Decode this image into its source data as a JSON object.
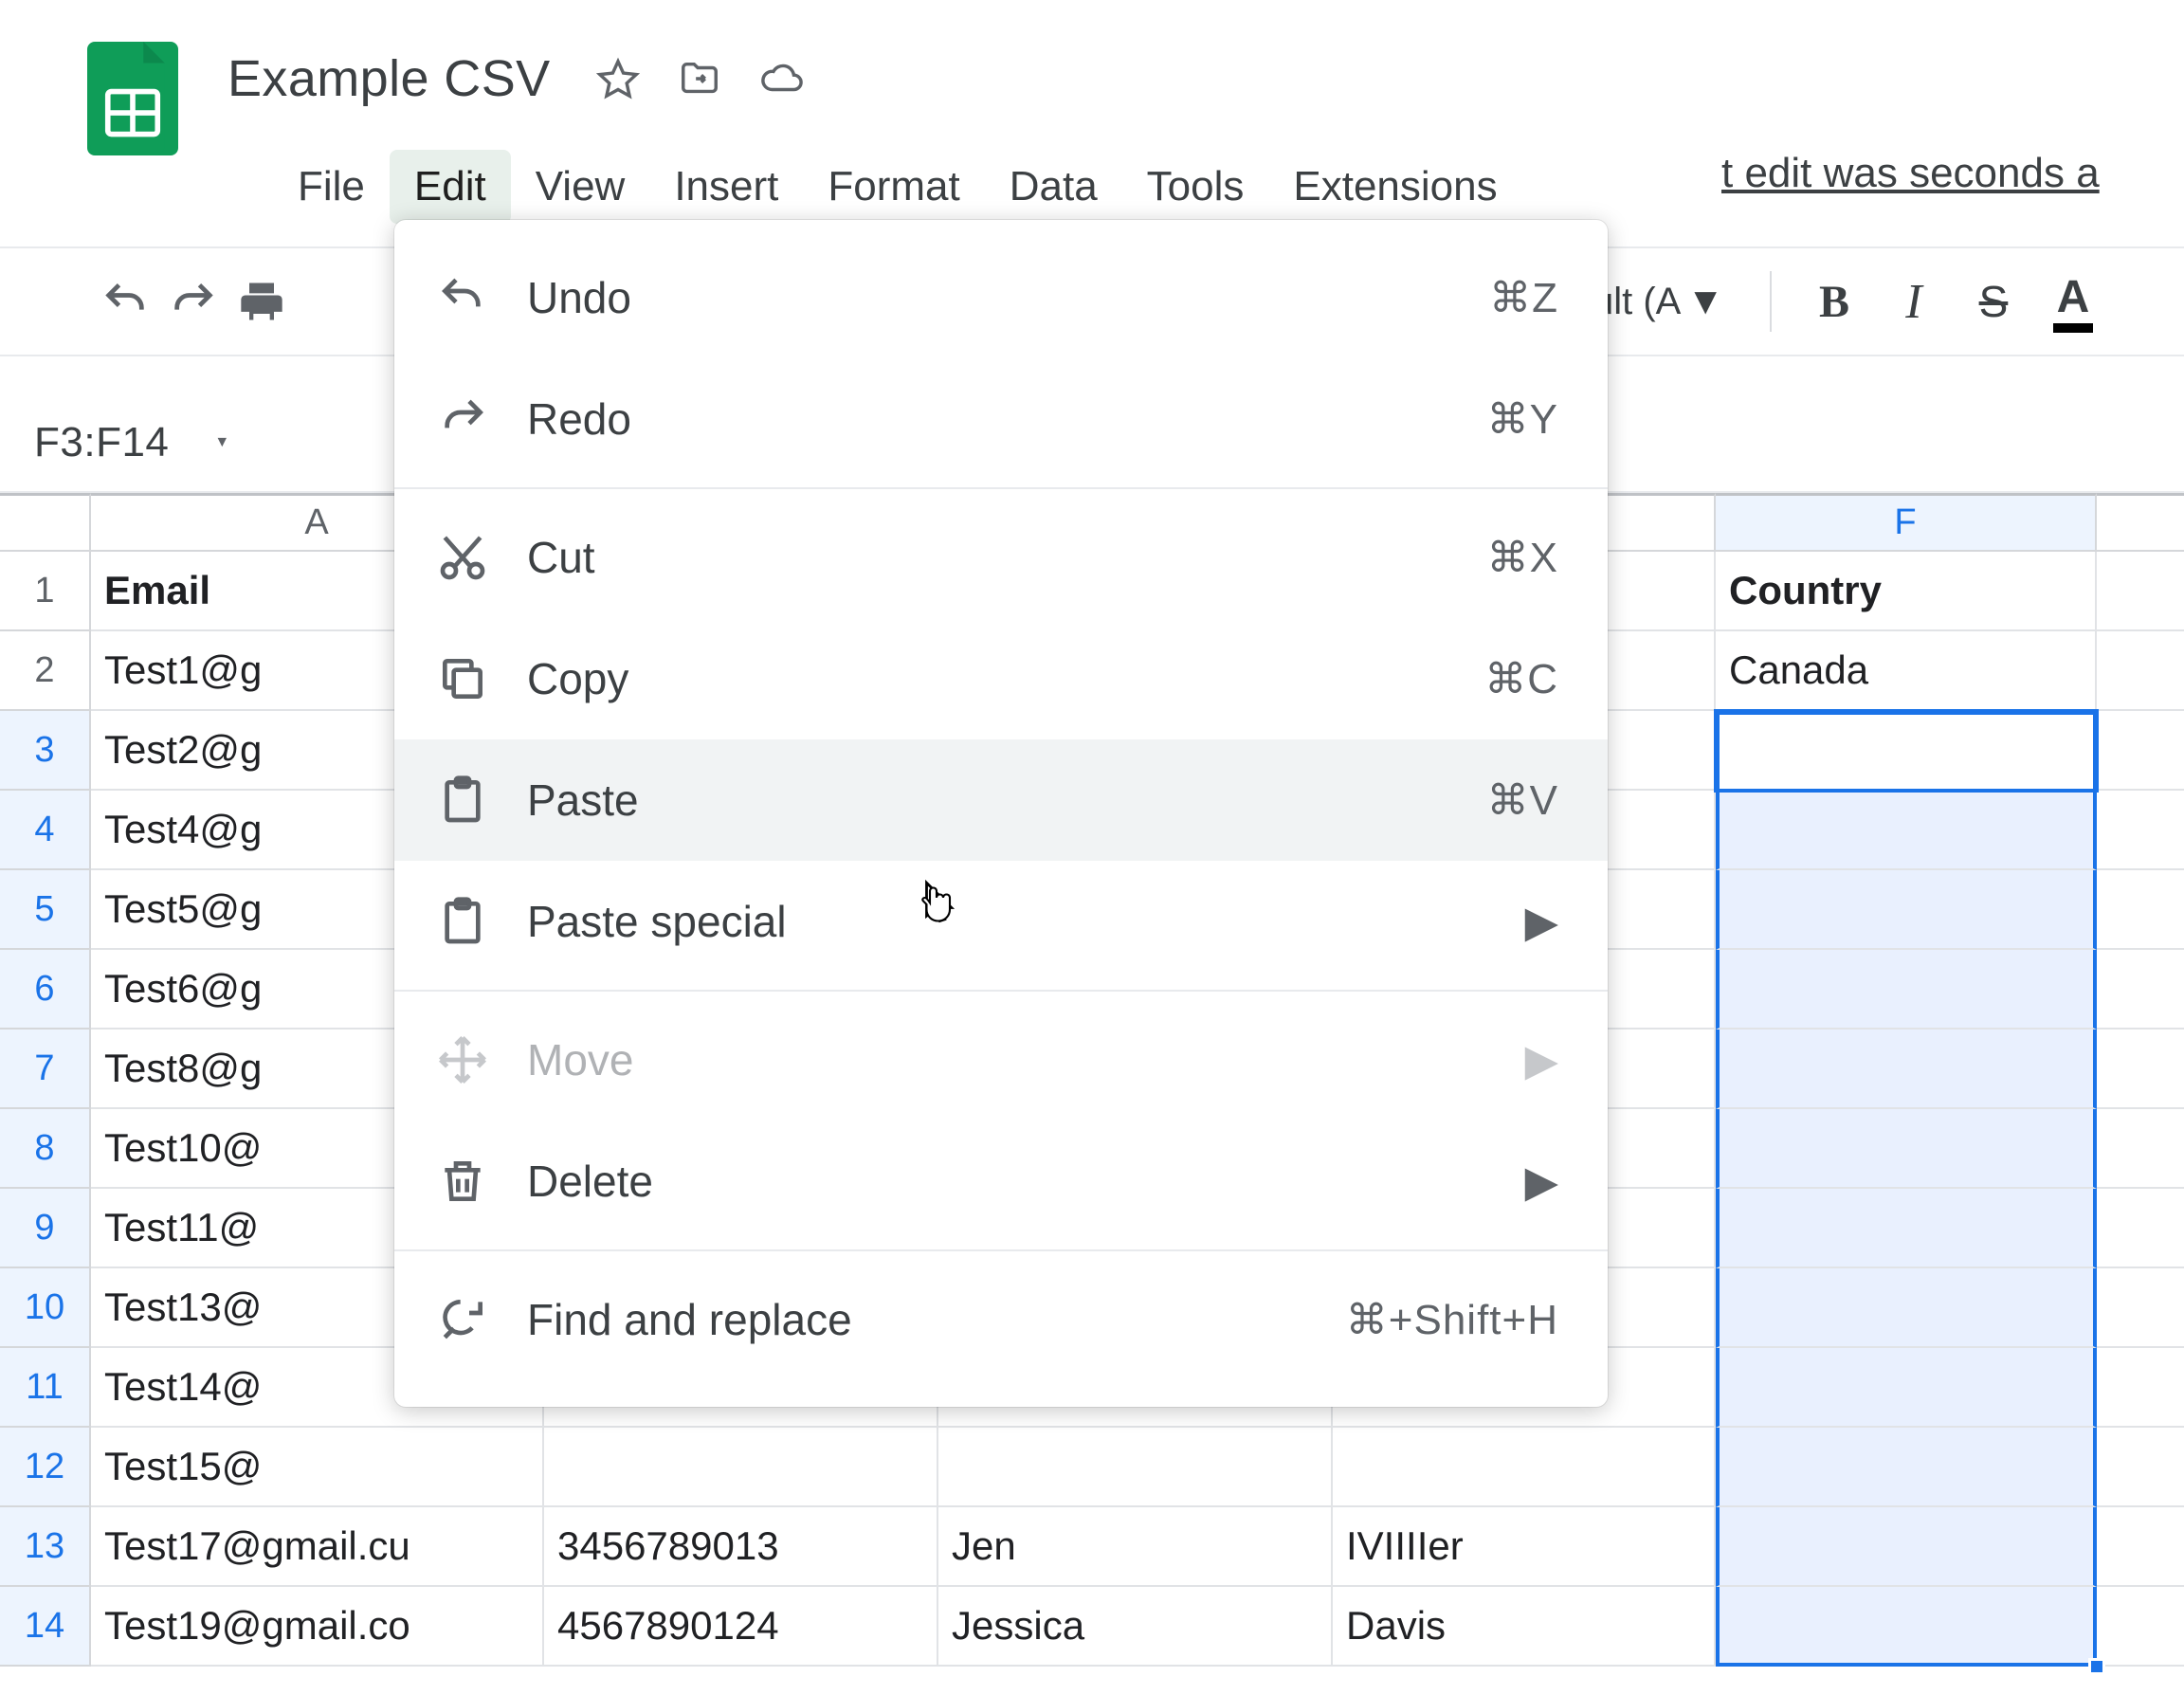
{
  "doc": {
    "title": "Example CSV"
  },
  "menubar": {
    "items": [
      "File",
      "Edit",
      "View",
      "Insert",
      "Format",
      "Data",
      "Tools",
      "Extensions"
    ],
    "active_index": 1,
    "status_tail": "t edit was seconds a"
  },
  "toolbar": {
    "font_label": "ult (A",
    "bold": "B",
    "italic": "I",
    "strike": "S",
    "textcolor": "A"
  },
  "namebox": {
    "value": "F3:F14"
  },
  "grid": {
    "col_headers": [
      "A",
      "F"
    ],
    "rows": [
      {
        "n": "1",
        "A": "Email",
        "B": "",
        "C": "",
        "D": "",
        "F": "Country",
        "Abold": true,
        "Fbold": true
      },
      {
        "n": "2",
        "A": "Test1@g",
        "B": "",
        "C": "",
        "D": "",
        "F": "Canada"
      },
      {
        "n": "3",
        "A": "Test2@g",
        "B": "",
        "C": "",
        "D": "",
        "F": ""
      },
      {
        "n": "4",
        "A": "Test4@g",
        "B": "",
        "C": "",
        "D": "",
        "F": ""
      },
      {
        "n": "5",
        "A": "Test5@g",
        "B": "",
        "C": "",
        "D": "",
        "F": ""
      },
      {
        "n": "6",
        "A": "Test6@g",
        "B": "",
        "C": "",
        "D": "",
        "F": ""
      },
      {
        "n": "7",
        "A": "Test8@g",
        "B": "",
        "C": "",
        "D": "",
        "F": ""
      },
      {
        "n": "8",
        "A": "Test10@",
        "B": "",
        "C": "",
        "D": "",
        "F": ""
      },
      {
        "n": "9",
        "A": "Test11@",
        "B": "",
        "C": "",
        "D": "",
        "F": ""
      },
      {
        "n": "10",
        "A": "Test13@",
        "B": "",
        "C": "",
        "D": "",
        "F": ""
      },
      {
        "n": "11",
        "A": "Test14@",
        "B": "",
        "C": "",
        "D": "",
        "F": ""
      },
      {
        "n": "12",
        "A": "Test15@",
        "B": "",
        "C": "",
        "D": "",
        "F": ""
      },
      {
        "n": "13",
        "A": "Test17@gmail.cu",
        "B": "3456789013",
        "C": "Jen",
        "D": "IVIIIIer",
        "F": ""
      },
      {
        "n": "14",
        "A": "Test19@gmail.co",
        "B": "4567890124",
        "C": "Jessica",
        "D": "Davis",
        "F": ""
      }
    ],
    "selection": {
      "col": "F",
      "from_row": 3,
      "to_row": 14,
      "active_row": 3
    }
  },
  "edit_menu": {
    "items": [
      {
        "icon": "undo",
        "label": "Undo",
        "shortcut": "⌘Z"
      },
      {
        "icon": "redo",
        "label": "Redo",
        "shortcut": "⌘Y"
      },
      {
        "sep": true
      },
      {
        "icon": "cut",
        "label": "Cut",
        "shortcut": "⌘X"
      },
      {
        "icon": "copy",
        "label": "Copy",
        "shortcut": "⌘C"
      },
      {
        "icon": "paste",
        "label": "Paste",
        "shortcut": "⌘V",
        "hover": true
      },
      {
        "icon": "paste",
        "label": "Paste special",
        "submenu": true
      },
      {
        "sep": true
      },
      {
        "icon": "move",
        "label": "Move",
        "submenu": true,
        "disabled": true
      },
      {
        "icon": "delete",
        "label": "Delete",
        "submenu": true
      },
      {
        "sep": true
      },
      {
        "icon": "findreplace",
        "label": "Find and replace",
        "shortcut": "⌘+Shift+H"
      }
    ]
  }
}
